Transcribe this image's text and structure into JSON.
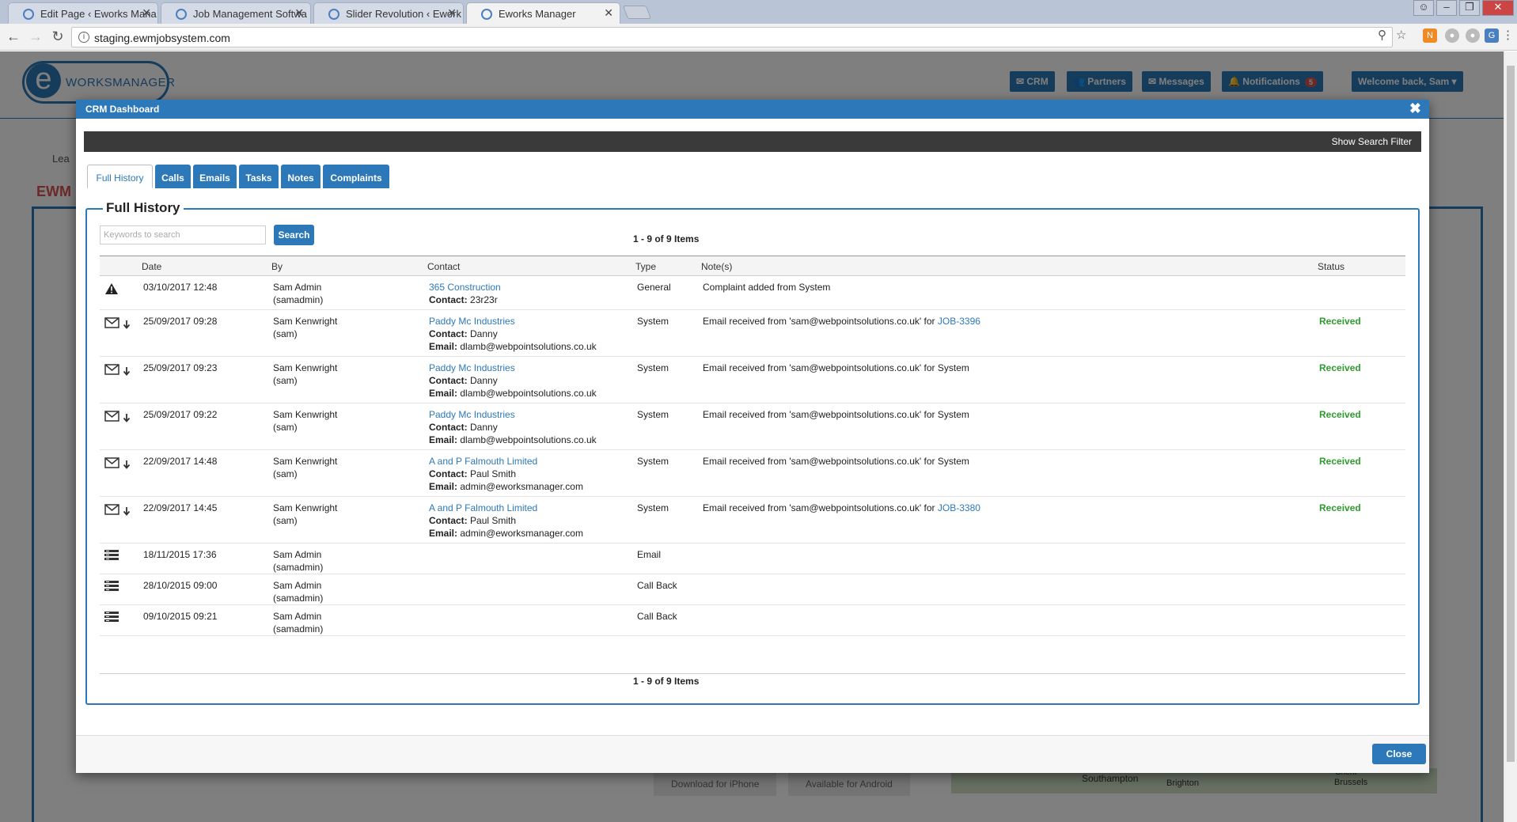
{
  "browser": {
    "tabs": [
      {
        "title": "Edit Page ‹ Eworks Mana"
      },
      {
        "title": "Job Management Softwa"
      },
      {
        "title": "Slider Revolution ‹ Ework"
      },
      {
        "title": "Eworks Manager"
      }
    ],
    "url": "staging.ewmjobsystem.com"
  },
  "header": {
    "logo_text": "WORKSMANAGER",
    "nav": {
      "crm": "CRM",
      "partners": "Partners",
      "messages": "Messages",
      "notifications": "Notifications",
      "notification_count": "5",
      "welcome": "Welcome back, Sam"
    }
  },
  "background": {
    "ewm_label": "EWM",
    "leads_label": "Lea",
    "download_iphone": "Download for iPhone",
    "available_android": "Available for Android",
    "map_labels": [
      "Southampton",
      "Brighton",
      "Brussels",
      "Ghent"
    ]
  },
  "modal": {
    "title": "CRM Dashboard",
    "show_search_filter": "Show Search Filter",
    "tabs": [
      "Full History",
      "Calls",
      "Emails",
      "Tasks",
      "Notes",
      "Complaints"
    ],
    "section_title": "Full History",
    "search_placeholder": "Keywords to search",
    "search_button": "Search",
    "pager_text": "1 - 9 of 9 Items",
    "close_button": "Close",
    "columns": {
      "date": "Date",
      "by": "By",
      "contact": "Contact",
      "type": "Type",
      "notes": "Note(s)",
      "status": "Status"
    },
    "contact_label": "Contact:",
    "email_label": "Email:",
    "rows": [
      {
        "icon": "warning-icon",
        "date": "03/10/2017 12:48",
        "by_name": "Sam Admin",
        "by_user": "(samadmin)",
        "company": "365 Construction",
        "contact": "23r23r",
        "email": "",
        "type": "General",
        "note": "Complaint added from System",
        "note_link": "",
        "status": ""
      },
      {
        "icon": "email-received-icon",
        "date": "25/09/2017 09:28",
        "by_name": "Sam Kenwright",
        "by_user": "(sam)",
        "company": "Paddy Mc Industries",
        "contact": "Danny",
        "email": "dlamb@webpointsolutions.co.uk",
        "type": "System",
        "note": "Email received from 'sam@webpointsolutions.co.uk' for",
        "note_link": "JOB-3396",
        "status": "Received"
      },
      {
        "icon": "email-received-icon",
        "date": "25/09/2017 09:23",
        "by_name": "Sam Kenwright",
        "by_user": "(sam)",
        "company": "Paddy Mc Industries",
        "contact": "Danny",
        "email": "dlamb@webpointsolutions.co.uk",
        "type": "System",
        "note": "Email received from 'sam@webpointsolutions.co.uk' for System",
        "note_link": "",
        "status": "Received"
      },
      {
        "icon": "email-received-icon",
        "date": "25/09/2017 09:22",
        "by_name": "Sam Kenwright",
        "by_user": "(sam)",
        "company": "Paddy Mc Industries",
        "contact": "Danny",
        "email": "dlamb@webpointsolutions.co.uk",
        "type": "System",
        "note": "Email received from 'sam@webpointsolutions.co.uk' for System",
        "note_link": "",
        "status": "Received"
      },
      {
        "icon": "email-received-icon",
        "date": "22/09/2017 14:48",
        "by_name": "Sam Kenwright",
        "by_user": "(sam)",
        "company": "A and P Falmouth Limited",
        "contact": "Paul Smith",
        "email": "admin@eworksmanager.com",
        "type": "System",
        "note": "Email received from 'sam@webpointsolutions.co.uk' for System",
        "note_link": "",
        "status": "Received"
      },
      {
        "icon": "email-received-icon",
        "date": "22/09/2017 14:45",
        "by_name": "Sam Kenwright",
        "by_user": "(sam)",
        "company": "A and P Falmouth Limited",
        "contact": "Paul Smith",
        "email": "admin@eworksmanager.com",
        "type": "System",
        "note": "Email received from 'sam@webpointsolutions.co.uk' for",
        "note_link": "JOB-3380",
        "status": "Received"
      },
      {
        "icon": "list-icon",
        "date": "18/11/2015 17:36",
        "by_name": "Sam Admin",
        "by_user": "(samadmin)",
        "company": "",
        "contact": "",
        "email": "",
        "type": "Email",
        "note": "",
        "note_link": "",
        "status": ""
      },
      {
        "icon": "list-icon",
        "date": "28/10/2015 09:00",
        "by_name": "Sam Admin",
        "by_user": "(samadmin)",
        "company": "",
        "contact": "",
        "email": "",
        "type": "Call Back",
        "note": "",
        "note_link": "",
        "status": ""
      },
      {
        "icon": "list-icon",
        "date": "09/10/2015 09:21",
        "by_name": "Sam Admin",
        "by_user": "(samadmin)",
        "company": "",
        "contact": "",
        "email": "",
        "type": "Call Back",
        "note": "",
        "note_link": "",
        "status": ""
      }
    ]
  },
  "colors": {
    "accent": "#2d78b8",
    "received": "#2e9b2e",
    "badge": "#d9534f",
    "search_bar": "#3a3a3a"
  }
}
